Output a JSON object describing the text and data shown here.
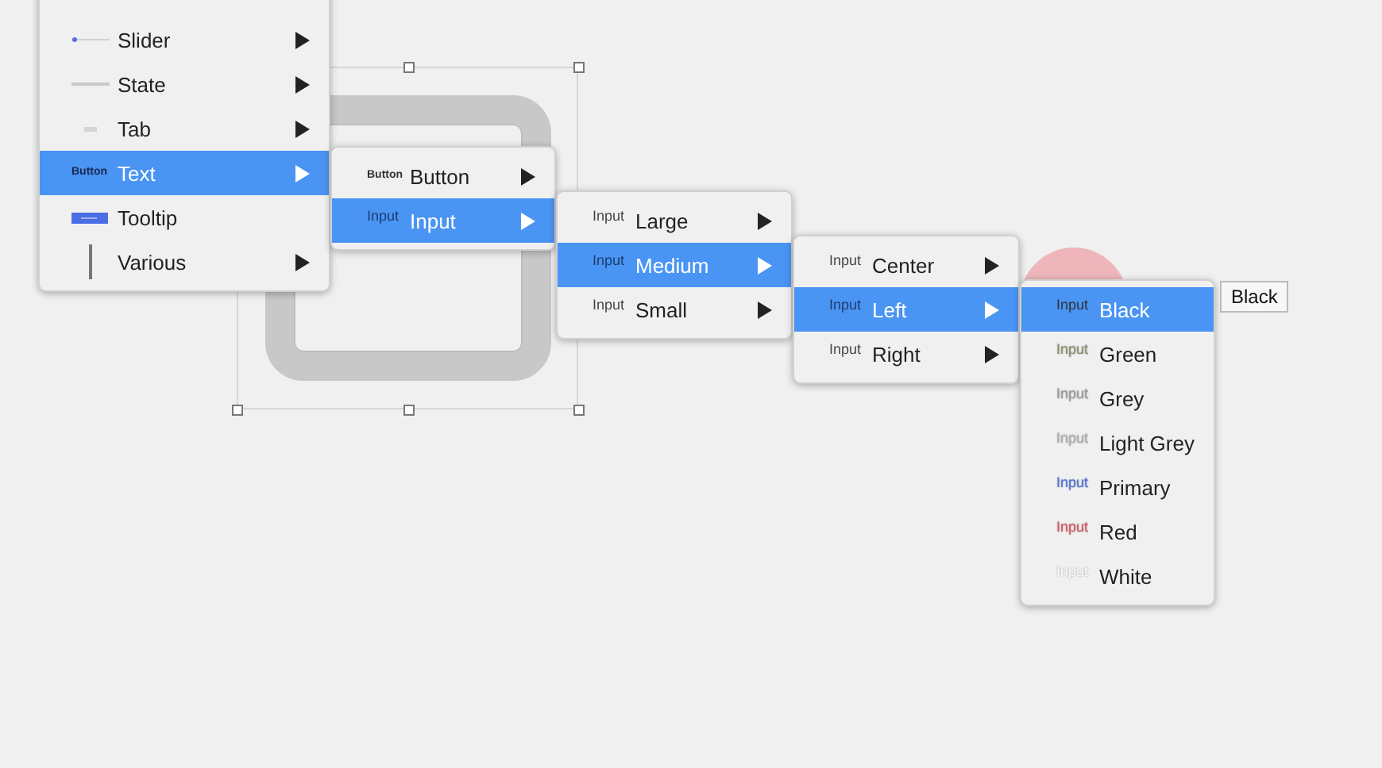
{
  "menus": [
    {
      "items": [
        {
          "label": "Slider",
          "kind": "slider",
          "selected": false,
          "has_submenu": true
        },
        {
          "label": "State",
          "kind": "state",
          "selected": false,
          "has_submenu": true
        },
        {
          "label": "Tab",
          "kind": "tab",
          "selected": false,
          "has_submenu": true
        },
        {
          "label": "Text",
          "kind": "text",
          "preview": "Button",
          "selected": true,
          "has_submenu": true
        },
        {
          "label": "Tooltip",
          "kind": "tooltip",
          "selected": false,
          "has_submenu": false
        },
        {
          "label": "Various",
          "kind": "various",
          "selected": false,
          "has_submenu": true
        }
      ]
    },
    {
      "items": [
        {
          "label": "Button",
          "kind": "text",
          "preview": "Button",
          "selected": false,
          "has_submenu": true
        },
        {
          "label": "Input",
          "kind": "text",
          "preview": "Input",
          "selected": true,
          "has_submenu": true
        }
      ]
    },
    {
      "items": [
        {
          "label": "Large",
          "kind": "text",
          "preview": "Input",
          "selected": false,
          "has_submenu": true
        },
        {
          "label": "Medium",
          "kind": "text",
          "preview": "Input",
          "selected": true,
          "has_submenu": true
        },
        {
          "label": "Small",
          "kind": "text",
          "preview": "Input",
          "selected": false,
          "has_submenu": true
        }
      ]
    },
    {
      "items": [
        {
          "label": "Center",
          "kind": "text",
          "preview": "Input",
          "selected": false,
          "has_submenu": true
        },
        {
          "label": "Left",
          "kind": "text",
          "preview": "Input",
          "selected": true,
          "has_submenu": true
        },
        {
          "label": "Right",
          "kind": "text",
          "preview": "Input",
          "selected": false,
          "has_submenu": true
        }
      ]
    },
    {
      "items": [
        {
          "label": "Black",
          "kind": "text",
          "preview": "Input",
          "color": "#333333",
          "selected": true,
          "has_submenu": false
        },
        {
          "label": "Green",
          "kind": "text",
          "preview": "Input",
          "color": "#8a8f6a",
          "selected": false,
          "has_submenu": false
        },
        {
          "label": "Grey",
          "kind": "text",
          "preview": "Input",
          "color": "#999999",
          "selected": false,
          "has_submenu": false
        },
        {
          "label": "Light Grey",
          "kind": "text",
          "preview": "Input",
          "color": "#b0b0b0",
          "selected": false,
          "has_submenu": false
        },
        {
          "label": "Primary",
          "kind": "text",
          "preview": "Input",
          "color": "#4a6fe0",
          "selected": false,
          "has_submenu": false
        },
        {
          "label": "Red",
          "kind": "text",
          "preview": "Input",
          "color": "#e0505a",
          "selected": false,
          "has_submenu": false
        },
        {
          "label": "White",
          "kind": "text",
          "preview": "Input",
          "color": "#ffffff",
          "selected": false,
          "has_submenu": false
        }
      ]
    }
  ],
  "tooltip": {
    "text": "Black"
  }
}
